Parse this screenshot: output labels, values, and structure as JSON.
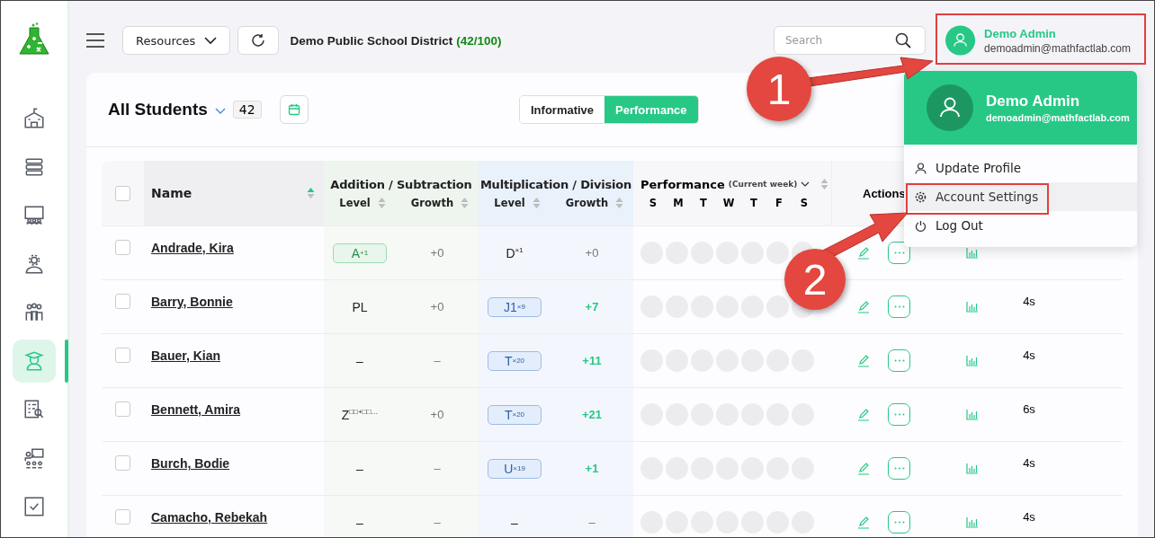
{
  "sidebar": {
    "items": [
      {
        "selected": false
      },
      {
        "selected": false
      },
      {
        "selected": false
      },
      {
        "selected": false
      },
      {
        "selected": false
      },
      {
        "selected": true
      },
      {
        "selected": false
      },
      {
        "selected": false
      },
      {
        "selected": false
      }
    ]
  },
  "toolbar": {
    "resources": "Resources",
    "district": "Demo Public School District",
    "district_count": "(42/100)",
    "search": {
      "placeholder": "Search"
    },
    "user": {
      "name": "Demo Admin",
      "email": "demoadmin@mathfactlab.com"
    }
  },
  "roster": {
    "title": "All Students",
    "count": "42",
    "view_toggle": [
      {
        "label": "Informative",
        "selected": false
      },
      {
        "label": "Performance",
        "selected": true
      }
    ]
  },
  "table": {
    "select_all": {
      "checked": false
    },
    "name_column": {
      "label": "Name",
      "sorted": true
    },
    "groups": [
      {
        "label": "Addition / Subtraction",
        "columns": [
          {
            "label": "Level",
            "sorted": false
          },
          {
            "label": "Growth",
            "sorted": false
          }
        ]
      },
      {
        "label": "Multiplication / Division",
        "columns": [
          {
            "label": "Level",
            "sorted": false
          },
          {
            "label": "Growth",
            "sorted": false
          }
        ]
      }
    ],
    "performance": {
      "label": "Performance",
      "note": "(Current week)",
      "days": [
        "S",
        "M",
        "T",
        "W",
        "T",
        "F",
        "S"
      ],
      "sorted": false
    },
    "actions_label": "Actions",
    "rows": [
      {
        "name": "Andrade, Kira",
        "checked": false,
        "add_level": {
          "base": "A",
          "sup": "+1",
          "badge": true
        },
        "add_growth": {
          "text": "+0",
          "gain": false
        },
        "mul_level": {
          "base": "D",
          "sup": "×1",
          "badge": false
        },
        "mul_growth": {
          "text": "+0",
          "gain": false
        }
      },
      {
        "name": "Barry, Bonnie",
        "checked": false,
        "add_level": {
          "base": "PL",
          "badge": false
        },
        "add_growth": {
          "text": "+0",
          "gain": false
        },
        "mul_level": {
          "base": "J1",
          "sup": "×9",
          "badge": true
        },
        "mul_growth": {
          "text": "+7",
          "gain": true
        },
        "time": "4s"
      },
      {
        "name": "Bauer, Kian",
        "checked": false,
        "add_level": {
          "base": "–",
          "badge": false
        },
        "add_growth": {
          "text": "–",
          "gain": false
        },
        "mul_level": {
          "base": "T",
          "sup": "×20",
          "badge": true
        },
        "mul_growth": {
          "text": "+11",
          "gain": true
        },
        "time": "4s"
      },
      {
        "name": "Bennett, Amira",
        "checked": false,
        "add_level": {
          "base": "Z",
          "sup": "□□+□□…",
          "badge": false
        },
        "add_growth": {
          "text": "+0",
          "gain": false
        },
        "mul_level": {
          "base": "T",
          "sup": "×20",
          "badge": true
        },
        "mul_growth": {
          "text": "+21",
          "gain": true
        },
        "time": "6s"
      },
      {
        "name": "Burch, Bodie",
        "checked": false,
        "add_level": {
          "base": "–",
          "badge": false
        },
        "add_growth": {
          "text": "–",
          "gain": false
        },
        "mul_level": {
          "base": "U",
          "sup": "×19",
          "badge": true
        },
        "mul_growth": {
          "text": "+1",
          "gain": true
        },
        "time": "4s"
      },
      {
        "name": "Camacho, Rebekah",
        "checked": false,
        "add_level": {
          "base": "–",
          "badge": false
        },
        "add_growth": {
          "text": "–",
          "gain": false
        },
        "mul_level": {
          "base": "–",
          "badge": false
        },
        "mul_growth": {
          "text": "–",
          "gain": false
        },
        "time": "4s"
      }
    ]
  },
  "user_menu": {
    "name": "Demo Admin",
    "email": "demoadmin@mathfactlab.com",
    "items": [
      {
        "label": "Update Profile",
        "highlighted": false
      },
      {
        "label": "Account Settings",
        "highlighted": true
      },
      {
        "label": "Log Out",
        "highlighted": false
      }
    ]
  },
  "annotations": [
    {
      "number": "1"
    },
    {
      "number": "2"
    }
  ]
}
